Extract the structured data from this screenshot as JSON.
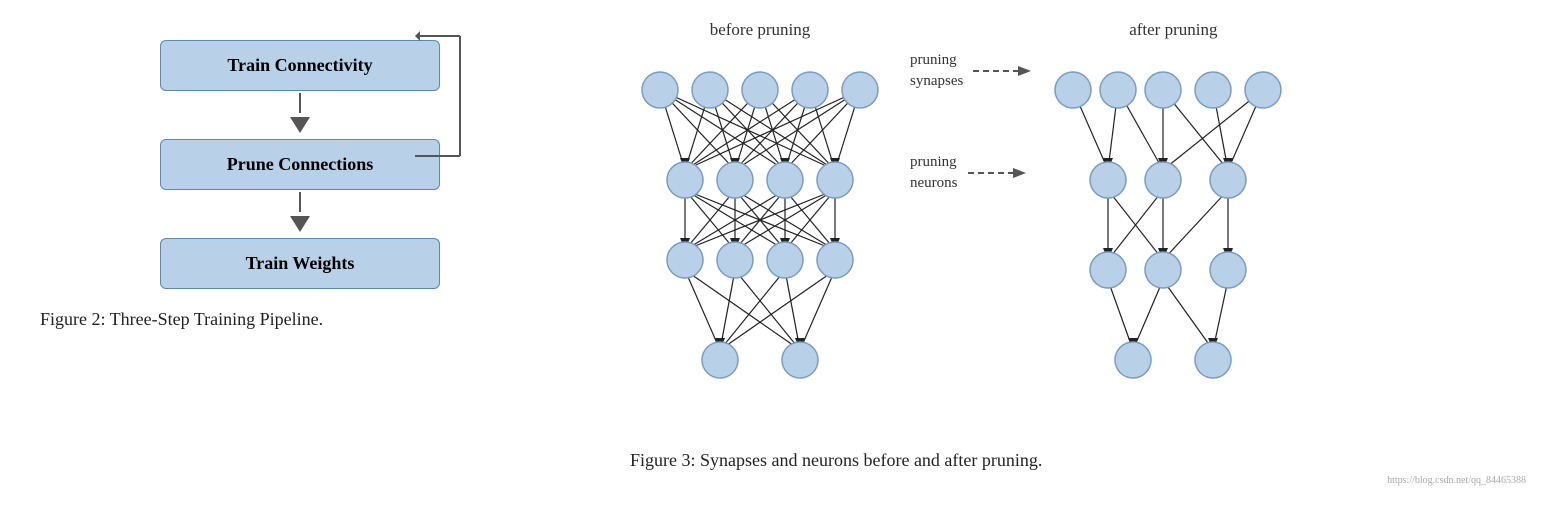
{
  "left": {
    "boxes": [
      {
        "label": "Train Connectivity"
      },
      {
        "label": "Prune Connections"
      },
      {
        "label": "Train Weights"
      }
    ],
    "caption": "Figure 2:  Three-Step Training Pipeline."
  },
  "right": {
    "before_label": "before pruning",
    "after_label": "after pruning",
    "pruning_synapses_label": "pruning\nsynapses",
    "pruning_neurons_label": "pruning\nneurons",
    "caption": "Figure 3:  Synapses and neurons before and after pruning.",
    "watermark": "https://blog.csdn.net/qq_84465388"
  }
}
